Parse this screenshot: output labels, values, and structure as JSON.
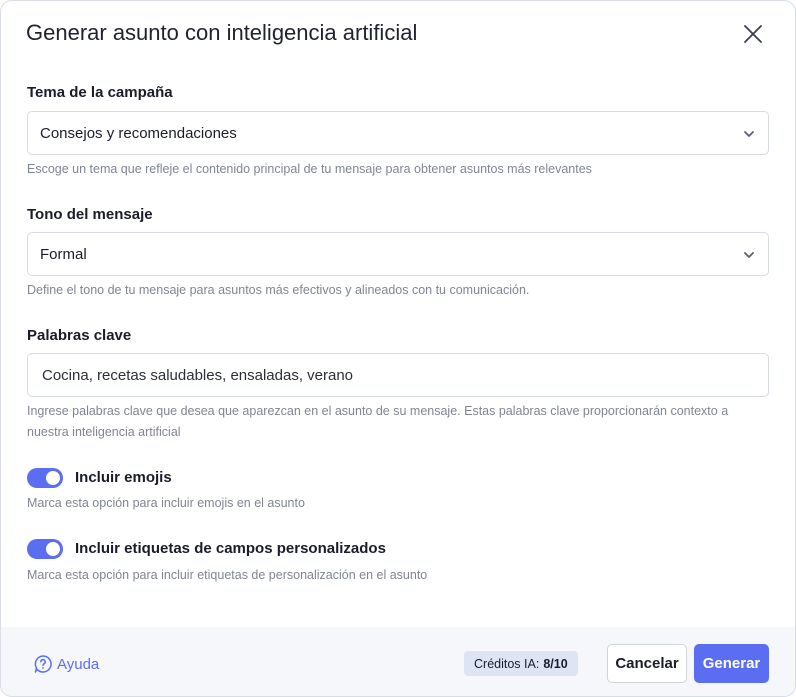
{
  "dialog": {
    "title": "Generar asunto con inteligencia artificial",
    "close_icon": "close-icon"
  },
  "topic": {
    "label": "Tema de la campaña",
    "value": "Consejos y recomendaciones",
    "help": "Escoge un tema que refleje el contenido principal de tu mensaje para obtener asuntos más relevantes"
  },
  "tone": {
    "label": "Tono del mensaje",
    "value": "Formal",
    "help": "Define el tono de tu mensaje para asuntos más efectivos y alineados con tu comunicación."
  },
  "keywords": {
    "label": "Palabras clave",
    "value": "Cocina, recetas saludables, ensaladas, verano",
    "help_line1": "Ingrese palabras clave que desea que aparezcan en el asunto de su mensaje. Estas palabras clave proporcionarán contexto a",
    "help_line2": "nuestra inteligencia artificial"
  },
  "emojis": {
    "label": "Incluir emojis",
    "enabled": true,
    "help": "Marca esta opción para incluir emojis en el asunto"
  },
  "custom_fields": {
    "label": "Incluir etiquetas de campos personalizados",
    "enabled": true,
    "help": "Marca esta opción para incluir etiquetas de personalización en el asunto"
  },
  "footer": {
    "help_label": "Ayuda",
    "credits_label": "Créditos IA:",
    "credits_value": "8/10",
    "cancel_label": "Cancelar",
    "generate_label": "Generar"
  },
  "colors": {
    "accent": "#5b6ef2",
    "credits_bg": "#dde5f5",
    "footer_bg": "#f6f7fb"
  }
}
